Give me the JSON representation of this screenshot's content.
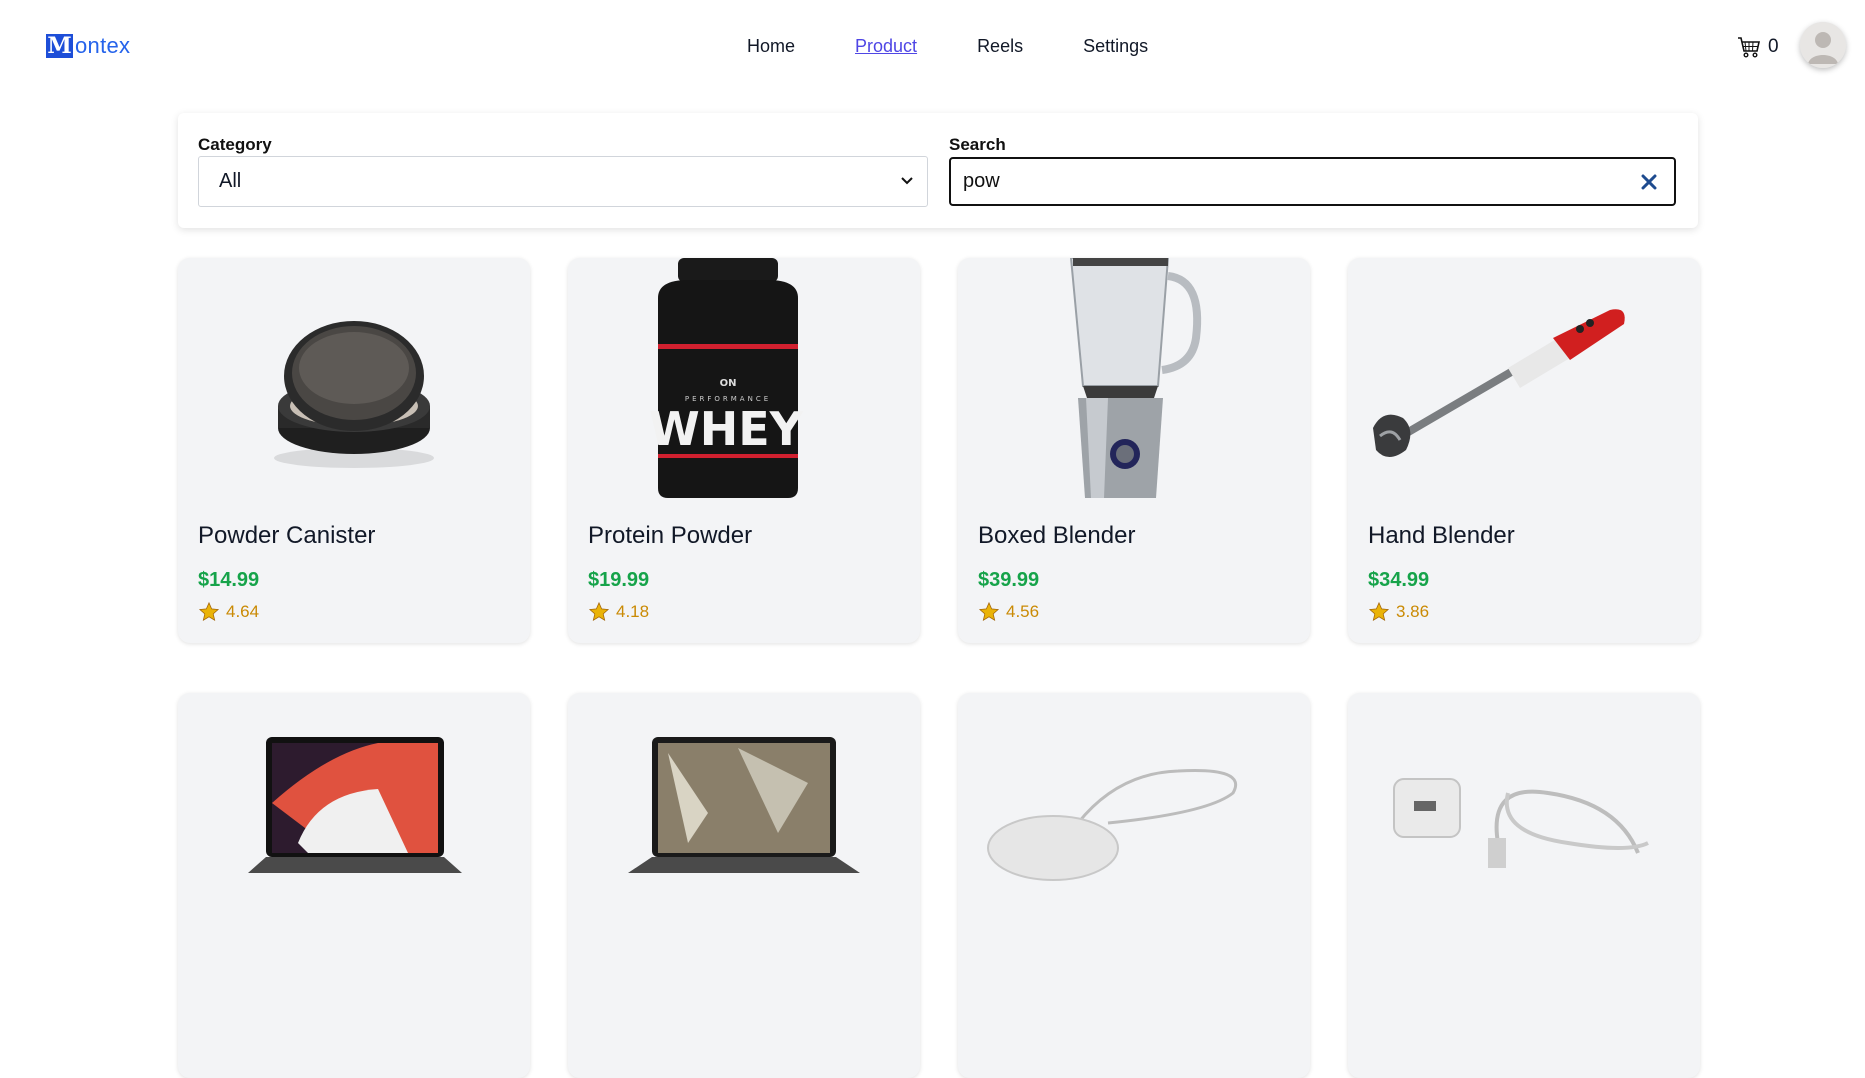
{
  "brand": {
    "mark": "M",
    "name": "ontex"
  },
  "nav": {
    "home": "Home",
    "product": "Product",
    "reels": "Reels",
    "settings": "Settings"
  },
  "cart": {
    "count": "0"
  },
  "filters": {
    "category_label": "Category",
    "category_value": "All",
    "search_label": "Search",
    "search_value": "pow"
  },
  "products": [
    {
      "name": "Powder Canister",
      "price": "$14.99",
      "rating": "4.64"
    },
    {
      "name": "Protein Powder",
      "price": "$19.99",
      "rating": "4.18"
    },
    {
      "name": "Boxed Blender",
      "price": "$39.99",
      "rating": "4.56"
    },
    {
      "name": "Hand Blender",
      "price": "$34.99",
      "rating": "3.86"
    }
  ],
  "product_images": {
    "whey_brand": "ON",
    "whey_line": "PERFORMANCE",
    "whey_name": "WHEY"
  },
  "colors": {
    "accent": "#4f46e5",
    "price": "#16a34a",
    "rating": "#ca8a04"
  }
}
